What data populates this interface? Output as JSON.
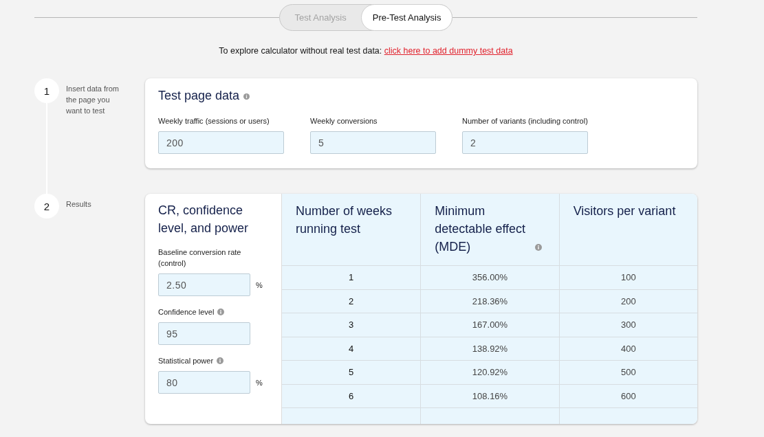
{
  "mode_tabs": [
    {
      "label": "Test Analysis",
      "selected": false
    },
    {
      "label": "Pre-Test Analysis",
      "selected": true
    }
  ],
  "notice": {
    "text": "To explore calculator without real test data:",
    "link": "click here to add dummy test data"
  },
  "steps": [
    {
      "number": "1",
      "label": "Insert data from the page you want to test",
      "kind": "inputs",
      "card": {
        "title": "Test page data",
        "info": true,
        "fields": [
          {
            "label": "Weekly traffic (sessions or users)",
            "value": "200"
          },
          {
            "label": "Weekly conversions",
            "value": "5"
          },
          {
            "label": "Number of variants (including control)",
            "value": "2"
          }
        ]
      }
    },
    {
      "number": "2",
      "label": "Results",
      "kind": "results",
      "settings": {
        "title": "CR, confidence level, and power",
        "fields": [
          {
            "label": "Baseline conversion rate (control)",
            "info": false,
            "value": "2.50",
            "unit": "%"
          },
          {
            "label": "Confidence level",
            "info": true,
            "value": "95"
          },
          {
            "label": "Statistical power",
            "info": true,
            "value": "80",
            "unit": "%"
          }
        ]
      },
      "table": {
        "columns": [
          {
            "label": "Number of weeks running test",
            "info": false
          },
          {
            "label": "Minimum detectable effect (MDE)",
            "info": true
          },
          {
            "label": "Visitors per variant",
            "info": false
          }
        ],
        "rows": [
          [
            "1",
            "356.00%",
            "100"
          ],
          [
            "2",
            "218.36%",
            "200"
          ],
          [
            "3",
            "167.00%",
            "300"
          ],
          [
            "4",
            "138.92%",
            "400"
          ],
          [
            "5",
            "120.92%",
            "500"
          ],
          [
            "6",
            "108.16%",
            "600"
          ]
        ]
      }
    }
  ]
}
